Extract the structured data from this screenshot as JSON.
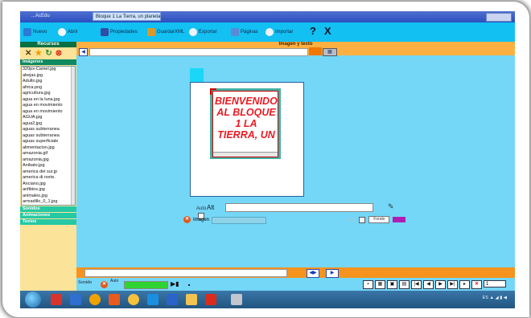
{
  "window": {
    "app_title": "...AcEdu",
    "tab_title": "Bloque 1 La Tierra, un planeta con vida"
  },
  "toolbar": {
    "nuevo": "Nuevo",
    "abrir": "Abrir",
    "propiedades": "Propiedades",
    "guardar_xml": "GuardarXML",
    "exportar": "Exportar",
    "paginas": "Páginas",
    "importar": "Importar",
    "help": "?",
    "close": "X"
  },
  "sidebar": {
    "recursos_title": "Recursos",
    "imagenes_label": "Imágenes",
    "files": [
      "320px-Camel.jpg",
      "abejas.jpg",
      "Adulto.jpg",
      "africa.png",
      "agricultura.jpg",
      "agua en la luna.jpg",
      "agua en movimiento",
      "agua en movimiento",
      "AGUA.jpg",
      "agua2.jpg",
      "aguas subterranea",
      "aguas subterranea",
      "aguas superficiale",
      "alimentacion.jpg",
      "amazonia.gif",
      "amazonia.jpg",
      "Anibato.jpg",
      "america del sur.jp",
      "america di norte.",
      "Anciano.jpg",
      "anfibios.jpg",
      "animales.jpg",
      "armadillo_0_1.jpg",
      "arena.jpg"
    ],
    "sonidos": "Sonidos",
    "animaciones": "Animaciones",
    "textos": "Textos"
  },
  "editor": {
    "section_title": "Imagen y texto",
    "card_text": "BIENVENIDOS AL BLOQUE 1 LA TIERRA, UN",
    "alt_small": "Auto",
    "alt_label": "Alt",
    "imagen_label": "Imagen",
    "fondo_label": "Fondo",
    "auto_label": "Auto"
  },
  "bottom": {
    "sonido_label": "Sonido",
    "auto_label": "Auto",
    "page_number": "1"
  },
  "tray": {
    "lang": "ES",
    "time": "▲ ◢ ▮ ◀"
  },
  "colors": {
    "toolbar": "#12c0f2",
    "sidebar": "#fbe39a",
    "workspace": "#74d7f7",
    "orange_bar": "#fdb042",
    "card_text": "#ea1b22"
  }
}
